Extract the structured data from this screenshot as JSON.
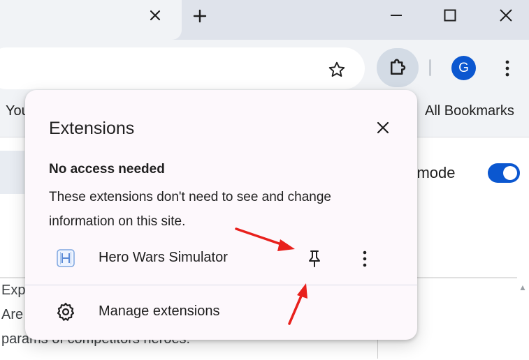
{
  "window": {
    "tab_close_icon": "close-icon",
    "new_tab_icon": "plus-icon"
  },
  "toolbar": {
    "bookmark_icon": "star-icon",
    "extensions_icon": "puzzle-icon",
    "avatar_letter": "G",
    "avatar_color": "#0b57d0",
    "menu_icon": "kebab-icon"
  },
  "bookmarks_bar": {
    "left_item": "You",
    "all_bookmarks": "All Bookmarks"
  },
  "page": {
    "mode_label": "r mode",
    "toggle_on": true,
    "line1": "Exp",
    "line2": "Are",
    "line3": "params of competitors heroes."
  },
  "extensions_popup": {
    "title": "Extensions",
    "section_heading": "No access needed",
    "section_description": "These extensions don't need to see and change information on this site.",
    "extensions": [
      {
        "name": "Hero Wars Simulator",
        "icon": "hero-wars-logo-icon",
        "pinned": false
      }
    ],
    "manage_label": "Manage extensions",
    "accent_color": "#fdf8fc"
  },
  "annotations": {
    "arrow_color": "#e8201c"
  }
}
